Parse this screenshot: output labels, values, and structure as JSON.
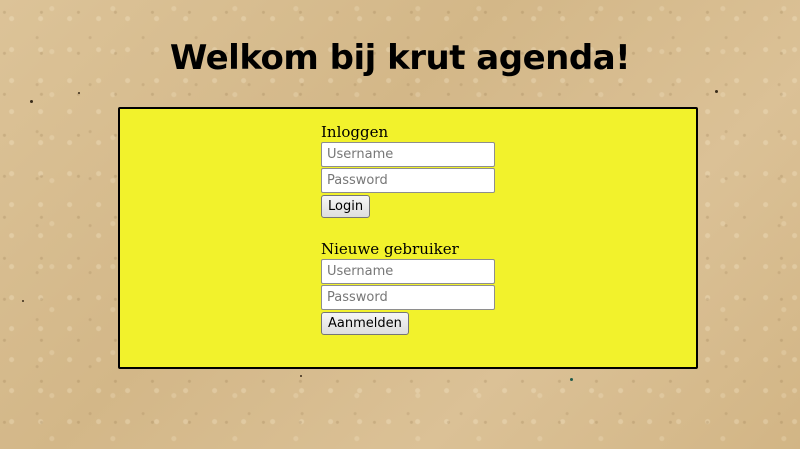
{
  "page": {
    "title": "Welkom bij krut agenda!"
  },
  "login": {
    "heading": "Inloggen",
    "username_placeholder": "Username",
    "password_placeholder": "Password",
    "button_label": "Login"
  },
  "register": {
    "heading": "Nieuwe gebruiker",
    "username_placeholder": "Username",
    "password_placeholder": "Password",
    "button_label": "Aanmelden"
  },
  "colors": {
    "background": "#d9bf92",
    "panel": "#f2f22c",
    "panel_border": "#000000"
  }
}
